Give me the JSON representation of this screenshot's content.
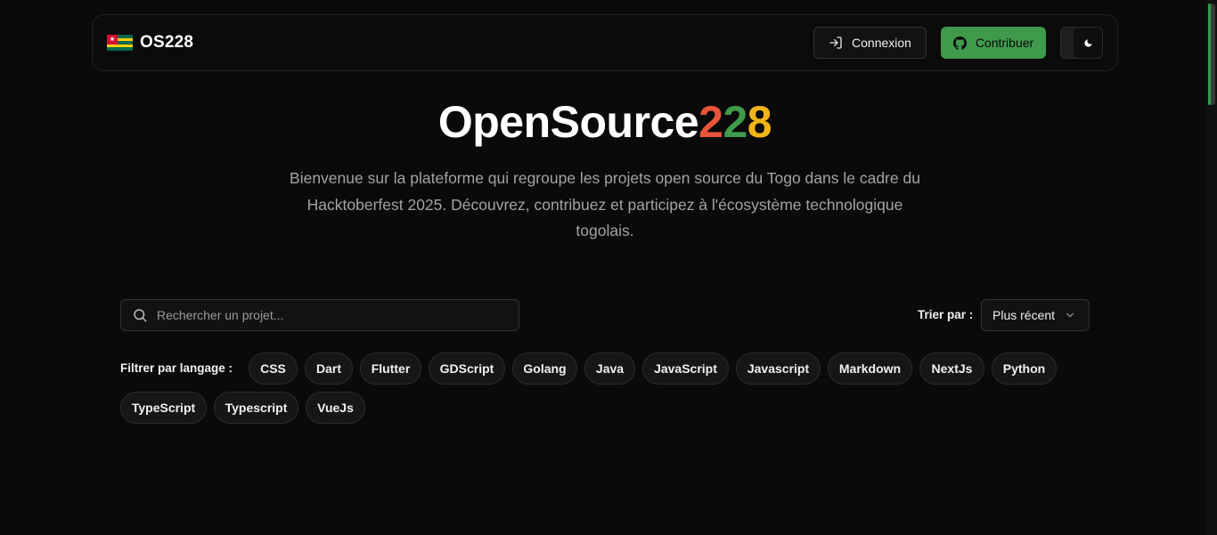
{
  "header": {
    "brand_name": "OS228",
    "login_label": "Connexion",
    "contribute_label": "Contribuer"
  },
  "hero": {
    "title_main": "OpenSource",
    "title_digit1": "2",
    "title_digit2": "2",
    "title_digit3": "8",
    "subtitle_line1": "Bienvenue sur la plateforme qui regroupe les projets open source du Togo dans le cadre du",
    "subtitle_line2": "Hacktoberfest 2025. Découvrez, contribuez et participez à l'écosystème technologique",
    "subtitle_line3": "togolais."
  },
  "search": {
    "placeholder": "Rechercher un projet..."
  },
  "sort": {
    "label": "Trier par :",
    "selected": "Plus récent"
  },
  "filter": {
    "label": "Filtrer par langage :",
    "languages": [
      "CSS",
      "Dart",
      "Flutter",
      "GDScript",
      "Golang",
      "Java",
      "JavaScript",
      "Javascript",
      "Markdown",
      "NextJs",
      "Python",
      "TypeScript",
      "Typescript",
      "VueJs"
    ]
  },
  "colors": {
    "background": "#0a0a0a",
    "accent_green": "#3f9a4c",
    "accent_red": "#e8553a",
    "accent_yellow": "#f2b418"
  },
  "icons": {
    "login": "log-in-icon",
    "contribute": "github-icon",
    "theme": "moon-icon",
    "search": "search-icon",
    "sort": "chevron-down-icon"
  }
}
